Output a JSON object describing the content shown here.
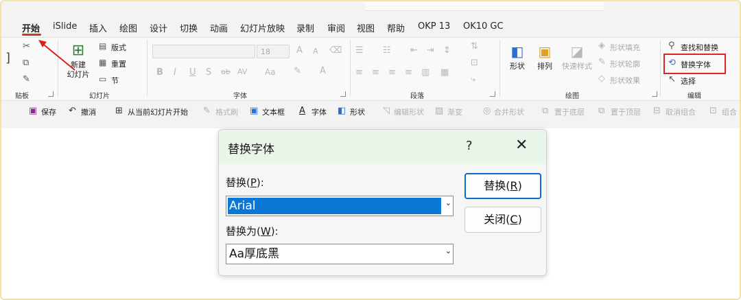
{
  "tabs": [
    "开始",
    "iSlide",
    "插入",
    "绘图",
    "设计",
    "切换",
    "动画",
    "幻灯片放映",
    "录制",
    "审阅",
    "视图",
    "帮助",
    "OKP 13",
    "OK10 GC"
  ],
  "ribbon": {
    "groups": {
      "clipboard": "贴板",
      "slides": "幻灯片",
      "font": "字体",
      "paragraph": "段落",
      "drawing": "绘图",
      "editing": "编辑"
    },
    "slides": {
      "new_slide_line1": "新建",
      "new_slide_line2": "幻灯片",
      "layout": "版式",
      "reset": "重置",
      "section": "节"
    },
    "font": {
      "size": "18",
      "bold": "B",
      "italic": "I",
      "underline": "U",
      "shadow": "S",
      "strike": "ab",
      "spacing": "AV",
      "case": "Aa",
      "grow": "A",
      "shrink": "A"
    },
    "drawing": {
      "shapes": "形状",
      "arrange": "排列",
      "quick_styles": "快速样式",
      "fill": "形状填充",
      "outline": "形状轮廓",
      "effects": "形状效果"
    },
    "editing": {
      "find_replace": "查找和替换",
      "replace_font": "替换字体",
      "select": "选择"
    }
  },
  "qat": {
    "save": "保存",
    "undo": "撤消",
    "from_current": "从当前幻灯片开始",
    "format_painter": "格式刷",
    "text_box": "文本框",
    "font": "字体",
    "shape": "形状",
    "edit_shape": "编辑形状",
    "gradient": "渐变",
    "merge_shapes": "合并形状",
    "send_back": "置于底层",
    "bring_front": "置于顶层",
    "ungroup": "取消组合",
    "group": "组合"
  },
  "dialog": {
    "title": "替换字体",
    "help": "?",
    "replace_label": "替换(",
    "replace_key": "P",
    "replace_tail": "):",
    "replace_value": "Arial",
    "with_label": "替换为(",
    "with_key": "W",
    "with_tail": "):",
    "with_value": "Aa厚底黑",
    "replace_btn": "替换(",
    "replace_btn_key": "R",
    "close_btn": "关闭(",
    "close_btn_key": "C",
    "btn_tail": ")"
  },
  "colors": {
    "accent_tab": "#c43e1c",
    "highlight": "#e02424",
    "selection": "#0b78d7"
  }
}
